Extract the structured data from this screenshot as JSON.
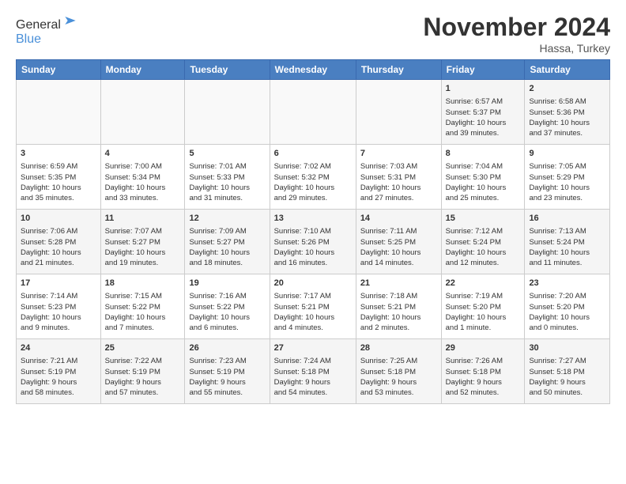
{
  "header": {
    "title": "November 2024",
    "location": "Hassa, Turkey"
  },
  "days_of_week": [
    "Sunday",
    "Monday",
    "Tuesday",
    "Wednesday",
    "Thursday",
    "Friday",
    "Saturday"
  ],
  "weeks": [
    [
      {
        "day": "",
        "info": ""
      },
      {
        "day": "",
        "info": ""
      },
      {
        "day": "",
        "info": ""
      },
      {
        "day": "",
        "info": ""
      },
      {
        "day": "",
        "info": ""
      },
      {
        "day": "1",
        "info": "Sunrise: 6:57 AM\nSunset: 5:37 PM\nDaylight: 10 hours\nand 39 minutes."
      },
      {
        "day": "2",
        "info": "Sunrise: 6:58 AM\nSunset: 5:36 PM\nDaylight: 10 hours\nand 37 minutes."
      }
    ],
    [
      {
        "day": "3",
        "info": "Sunrise: 6:59 AM\nSunset: 5:35 PM\nDaylight: 10 hours\nand 35 minutes."
      },
      {
        "day": "4",
        "info": "Sunrise: 7:00 AM\nSunset: 5:34 PM\nDaylight: 10 hours\nand 33 minutes."
      },
      {
        "day": "5",
        "info": "Sunrise: 7:01 AM\nSunset: 5:33 PM\nDaylight: 10 hours\nand 31 minutes."
      },
      {
        "day": "6",
        "info": "Sunrise: 7:02 AM\nSunset: 5:32 PM\nDaylight: 10 hours\nand 29 minutes."
      },
      {
        "day": "7",
        "info": "Sunrise: 7:03 AM\nSunset: 5:31 PM\nDaylight: 10 hours\nand 27 minutes."
      },
      {
        "day": "8",
        "info": "Sunrise: 7:04 AM\nSunset: 5:30 PM\nDaylight: 10 hours\nand 25 minutes."
      },
      {
        "day": "9",
        "info": "Sunrise: 7:05 AM\nSunset: 5:29 PM\nDaylight: 10 hours\nand 23 minutes."
      }
    ],
    [
      {
        "day": "10",
        "info": "Sunrise: 7:06 AM\nSunset: 5:28 PM\nDaylight: 10 hours\nand 21 minutes."
      },
      {
        "day": "11",
        "info": "Sunrise: 7:07 AM\nSunset: 5:27 PM\nDaylight: 10 hours\nand 19 minutes."
      },
      {
        "day": "12",
        "info": "Sunrise: 7:09 AM\nSunset: 5:27 PM\nDaylight: 10 hours\nand 18 minutes."
      },
      {
        "day": "13",
        "info": "Sunrise: 7:10 AM\nSunset: 5:26 PM\nDaylight: 10 hours\nand 16 minutes."
      },
      {
        "day": "14",
        "info": "Sunrise: 7:11 AM\nSunset: 5:25 PM\nDaylight: 10 hours\nand 14 minutes."
      },
      {
        "day": "15",
        "info": "Sunrise: 7:12 AM\nSunset: 5:24 PM\nDaylight: 10 hours\nand 12 minutes."
      },
      {
        "day": "16",
        "info": "Sunrise: 7:13 AM\nSunset: 5:24 PM\nDaylight: 10 hours\nand 11 minutes."
      }
    ],
    [
      {
        "day": "17",
        "info": "Sunrise: 7:14 AM\nSunset: 5:23 PM\nDaylight: 10 hours\nand 9 minutes."
      },
      {
        "day": "18",
        "info": "Sunrise: 7:15 AM\nSunset: 5:22 PM\nDaylight: 10 hours\nand 7 minutes."
      },
      {
        "day": "19",
        "info": "Sunrise: 7:16 AM\nSunset: 5:22 PM\nDaylight: 10 hours\nand 6 minutes."
      },
      {
        "day": "20",
        "info": "Sunrise: 7:17 AM\nSunset: 5:21 PM\nDaylight: 10 hours\nand 4 minutes."
      },
      {
        "day": "21",
        "info": "Sunrise: 7:18 AM\nSunset: 5:21 PM\nDaylight: 10 hours\nand 2 minutes."
      },
      {
        "day": "22",
        "info": "Sunrise: 7:19 AM\nSunset: 5:20 PM\nDaylight: 10 hours\nand 1 minute."
      },
      {
        "day": "23",
        "info": "Sunrise: 7:20 AM\nSunset: 5:20 PM\nDaylight: 10 hours\nand 0 minutes."
      }
    ],
    [
      {
        "day": "24",
        "info": "Sunrise: 7:21 AM\nSunset: 5:19 PM\nDaylight: 9 hours\nand 58 minutes."
      },
      {
        "day": "25",
        "info": "Sunrise: 7:22 AM\nSunset: 5:19 PM\nDaylight: 9 hours\nand 57 minutes."
      },
      {
        "day": "26",
        "info": "Sunrise: 7:23 AM\nSunset: 5:19 PM\nDaylight: 9 hours\nand 55 minutes."
      },
      {
        "day": "27",
        "info": "Sunrise: 7:24 AM\nSunset: 5:18 PM\nDaylight: 9 hours\nand 54 minutes."
      },
      {
        "day": "28",
        "info": "Sunrise: 7:25 AM\nSunset: 5:18 PM\nDaylight: 9 hours\nand 53 minutes."
      },
      {
        "day": "29",
        "info": "Sunrise: 7:26 AM\nSunset: 5:18 PM\nDaylight: 9 hours\nand 52 minutes."
      },
      {
        "day": "30",
        "info": "Sunrise: 7:27 AM\nSunset: 5:18 PM\nDaylight: 9 hours\nand 50 minutes."
      }
    ]
  ]
}
